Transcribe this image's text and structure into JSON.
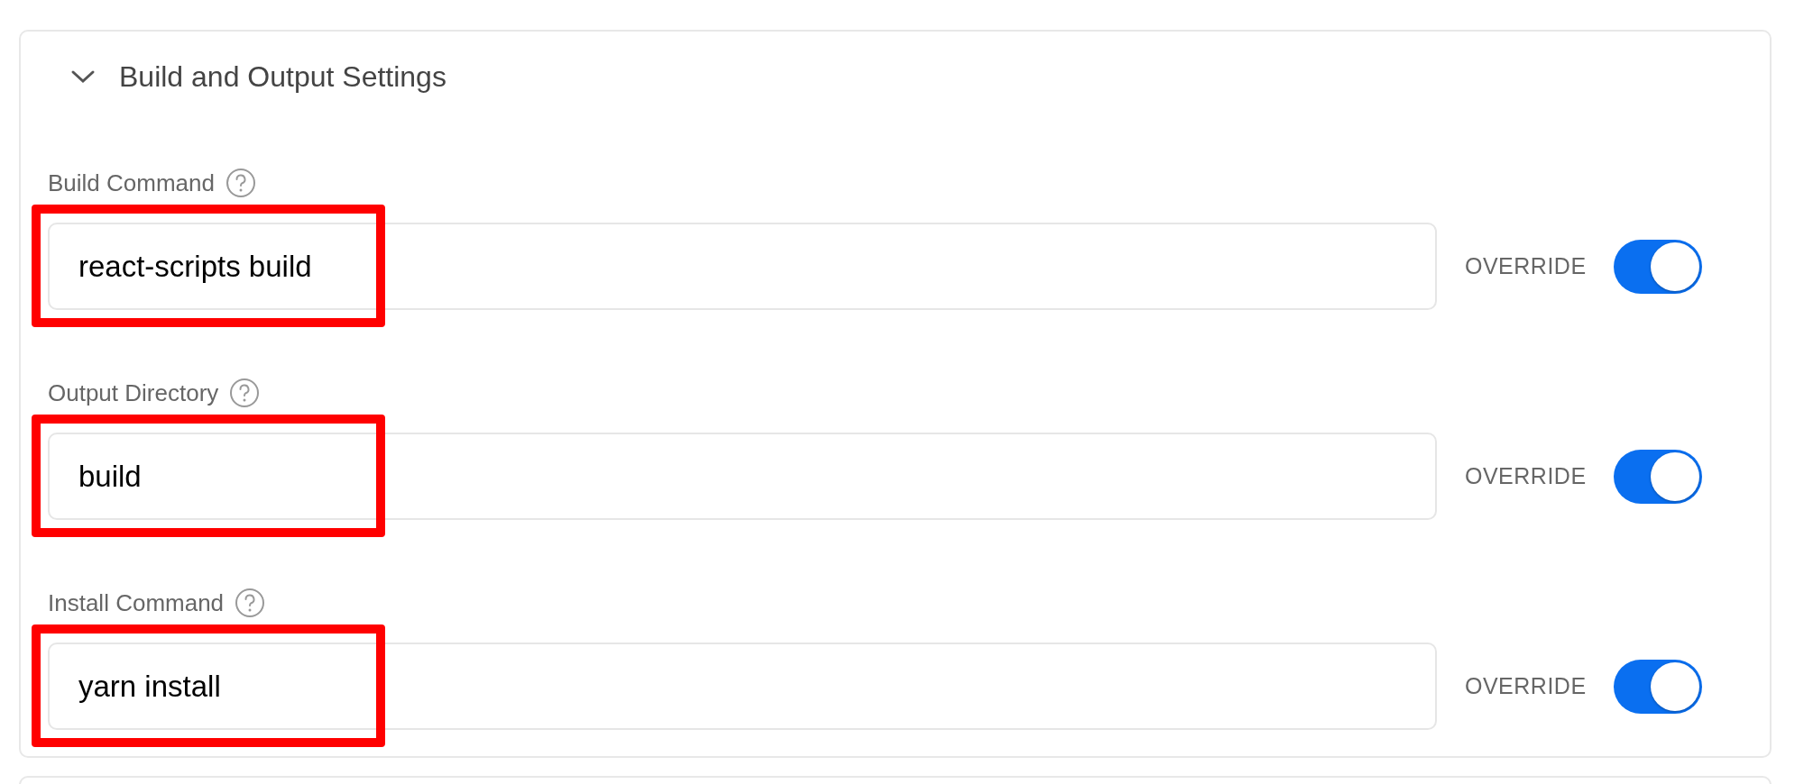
{
  "section": {
    "title": "Build and Output Settings",
    "expanded": true
  },
  "fields": [
    {
      "label": "Build Command",
      "value": "react-scripts build",
      "override_label": "OVERRIDE",
      "override": true,
      "highlighted": true
    },
    {
      "label": "Output Directory",
      "value": "build",
      "override_label": "OVERRIDE",
      "override": true,
      "highlighted": true
    },
    {
      "label": "Install Command",
      "value": "yarn install",
      "override_label": "OVERRIDE",
      "override": true,
      "highlighted": true
    }
  ]
}
